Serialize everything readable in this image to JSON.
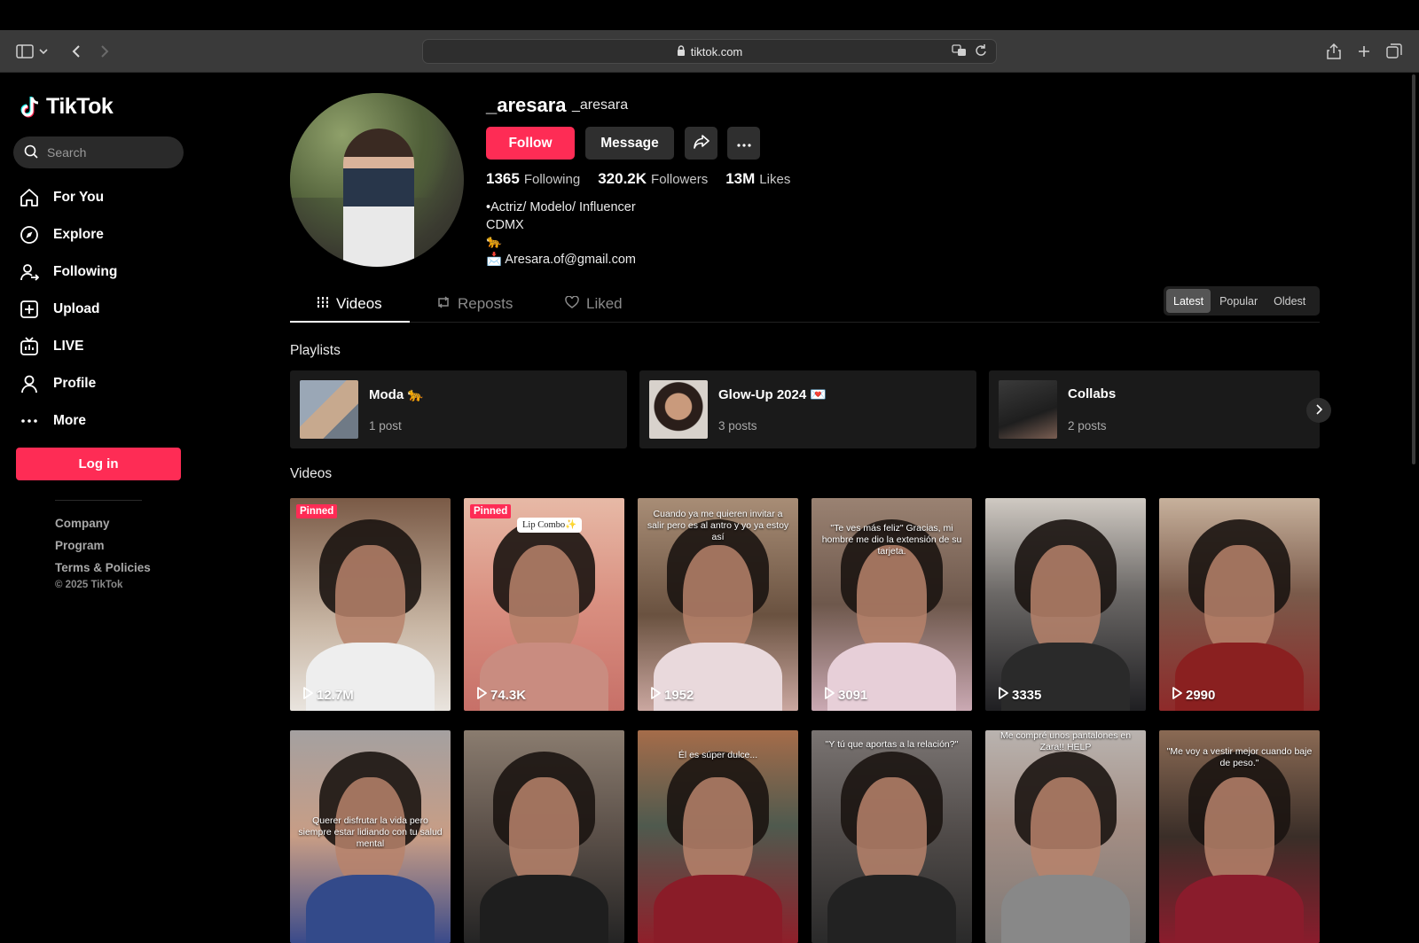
{
  "browser": {
    "url": "tiktok.com"
  },
  "sidebar": {
    "logo": "TikTok",
    "search_placeholder": "Search",
    "nav": [
      {
        "label": "For You",
        "icon": "home-icon"
      },
      {
        "label": "Explore",
        "icon": "compass-icon"
      },
      {
        "label": "Following",
        "icon": "user-plus-icon"
      },
      {
        "label": "Upload",
        "icon": "plus-square-icon"
      },
      {
        "label": "LIVE",
        "icon": "live-tv-icon"
      },
      {
        "label": "Profile",
        "icon": "person-icon"
      },
      {
        "label": "More",
        "icon": "more-dots-icon"
      }
    ],
    "login": "Log in",
    "footer": [
      "Company",
      "Program",
      "Terms & Policies"
    ],
    "copyright": "© 2025 TikTok"
  },
  "profile": {
    "username": "_aresara",
    "nickname": "_aresara",
    "follow": "Follow",
    "message": "Message",
    "stats": {
      "following": "1365",
      "following_label": "Following",
      "followers": "320.2K",
      "followers_label": "Followers",
      "likes": "13M",
      "likes_label": "Likes"
    },
    "bio": [
      "•Actriz/ Modelo/ Influencer",
      "CDMX",
      "🐆",
      "📩 Aresara.of@gmail.com"
    ]
  },
  "tabs": {
    "videos": "Videos",
    "reposts": "Reposts",
    "liked": "Liked"
  },
  "sort": [
    "Latest",
    "Popular",
    "Oldest"
  ],
  "playlists_title": "Playlists",
  "playlists": [
    {
      "title": "Moda 🐆",
      "count": "1 post"
    },
    {
      "title": "Glow-Up 2024 💌",
      "count": "3 posts"
    },
    {
      "title": "Collabs",
      "count": "2 posts"
    }
  ],
  "videos_title": "Videos",
  "videos": [
    {
      "views": "12.7M",
      "pinned": "Pinned",
      "caption": ""
    },
    {
      "views": "74.3K",
      "pinned": "Pinned",
      "caption": "Lip Combo✨"
    },
    {
      "views": "1952",
      "pinned": "",
      "caption": "Cuando ya me quieren invitar a salir pero es al antro y yo ya estoy así"
    },
    {
      "views": "3091",
      "pinned": "",
      "caption": "\"Te ves más feliz\" Gracias, mi hombre me dio la extensión de su tarjeta."
    },
    {
      "views": "3335",
      "pinned": "",
      "caption": ""
    },
    {
      "views": "2990",
      "pinned": "",
      "caption": ""
    },
    {
      "views": "",
      "pinned": "",
      "caption": "Querer disfrutar la vida pero siempre estar lidiando con tu salud mental"
    },
    {
      "views": "",
      "pinned": "",
      "caption": ""
    },
    {
      "views": "",
      "pinned": "",
      "caption": "Él es súper dulce..."
    },
    {
      "views": "",
      "pinned": "",
      "caption": "\"Y tú que aportas a la relación?\""
    },
    {
      "views": "",
      "pinned": "",
      "caption": "Me compré unos pantalones en Zara!! HELP"
    },
    {
      "views": "",
      "pinned": "",
      "caption": "\"Me voy a vestir mejor cuando baje de peso.\""
    }
  ],
  "colors": {
    "accent": "#fe2c55",
    "bg": "#000000",
    "surface": "#1a1a1a"
  }
}
